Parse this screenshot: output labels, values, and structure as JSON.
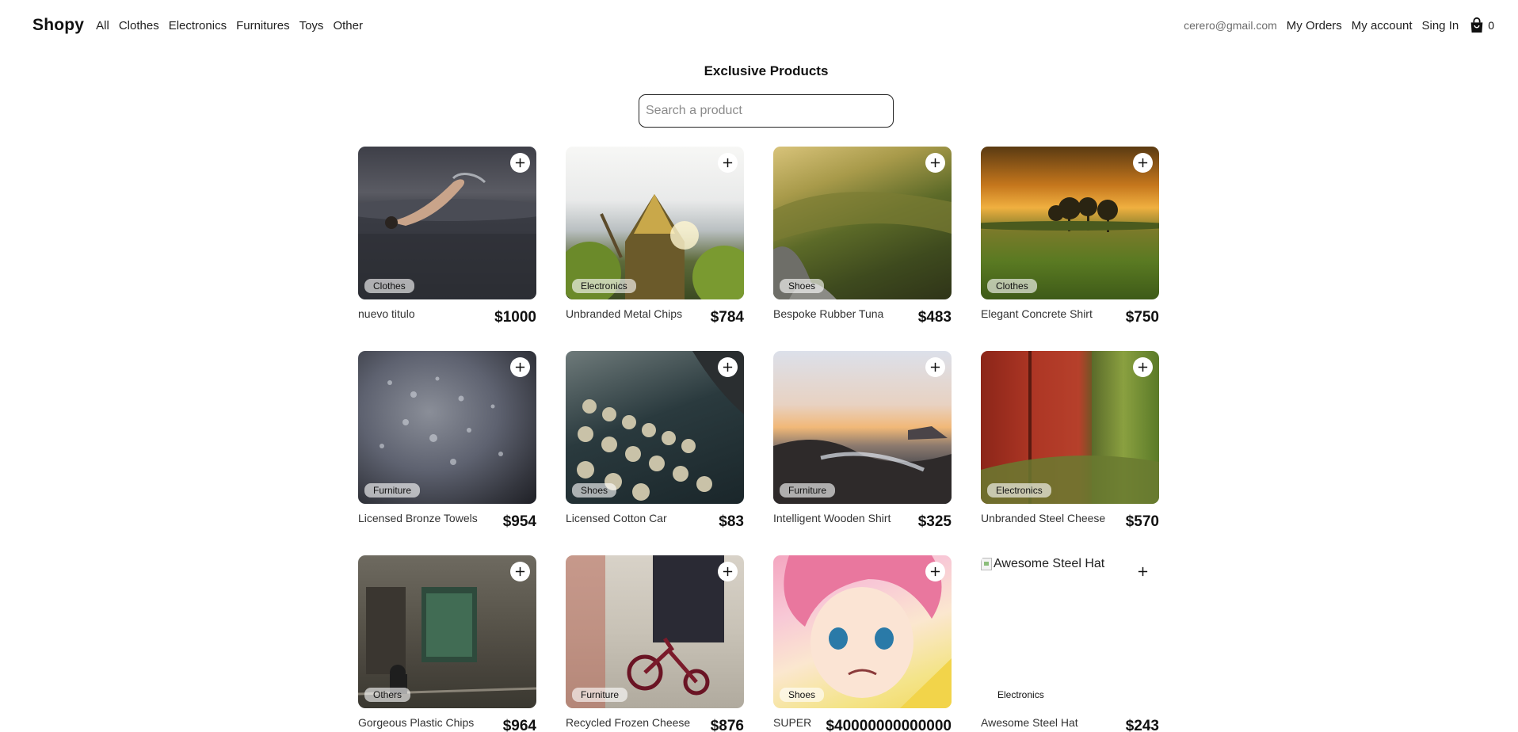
{
  "nav": {
    "brand": "Shopy",
    "categories": [
      "All",
      "Clothes",
      "Electronics",
      "Furnitures",
      "Toys",
      "Other"
    ],
    "email": "cerero@gmail.com",
    "my_orders": "My Orders",
    "my_account": "My account",
    "sign_in": "Sing In",
    "cart_count": "0",
    "cart_icon": "shopping-bag-icon"
  },
  "page": {
    "title": "Exclusive Products",
    "search_placeholder": "Search a product"
  },
  "products": [
    {
      "name": "nuevo titulo",
      "price": "$1000",
      "category": "Clothes",
      "image": "swimmer-in-lake"
    },
    {
      "name": "Unbranded Metal Chips",
      "price": "$784",
      "category": "Electronics",
      "image": "canoe-bow-sunlight"
    },
    {
      "name": "Bespoke Rubber Tuna",
      "price": "$483",
      "category": "Shoes",
      "image": "forest-mountain-mist"
    },
    {
      "name": "Elegant Concrete Shirt",
      "price": "$750",
      "category": "Clothes",
      "image": "sunset-field-trees"
    },
    {
      "name": "Licensed Bronze Towels",
      "price": "$954",
      "category": "Furniture",
      "image": "water-droplets-umbrella"
    },
    {
      "name": "Licensed Cotton Car",
      "price": "$83",
      "category": "Shoes",
      "image": "vintage-typewriter"
    },
    {
      "name": "Intelligent Wooden Shirt",
      "price": "$325",
      "category": "Furniture",
      "image": "rocky-coast-sunset"
    },
    {
      "name": "Unbranded Steel Cheese",
      "price": "$570",
      "category": "Electronics",
      "image": "red-wall-grass"
    },
    {
      "name": "Gorgeous Plastic Chips",
      "price": "$964",
      "category": "Others",
      "image": "old-building-cyclist"
    },
    {
      "name": "Recycled Frozen Cheese",
      "price": "$876",
      "category": "Furniture",
      "image": "red-tricycle-street"
    },
    {
      "name": "SUPER",
      "price": "$40000000000000",
      "category": "Shoes",
      "image": "anime-pink-hair-girl"
    },
    {
      "name": "Awesome Steel Hat",
      "price": "$243",
      "category": "Electronics",
      "image": "broken-image",
      "image_alt": "Awesome Steel Hat"
    }
  ],
  "icons": {
    "add": "plus-icon",
    "broken_image": "broken-image-icon"
  }
}
